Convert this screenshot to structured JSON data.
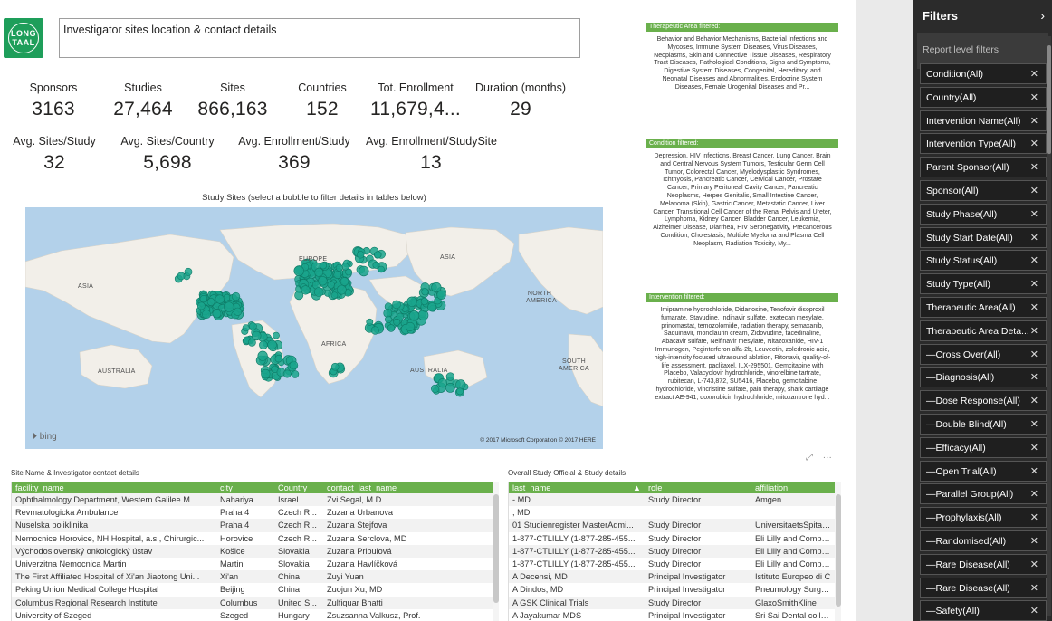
{
  "logo": {
    "line1": "LONG",
    "line2": "TAAL"
  },
  "report_title": "Investigator sites location & contact details",
  "kpis": [
    {
      "label": "Sponsors",
      "value": "3163"
    },
    {
      "label": "Studies",
      "value": "27,464"
    },
    {
      "label": "Sites",
      "value": "866,163"
    },
    {
      "label": "Countries",
      "value": "152"
    },
    {
      "label": "Tot. Enrollment",
      "value": "11,679,4..."
    },
    {
      "label": "Duration (months)",
      "value": "29"
    },
    {
      "label": "Avg. Sites/Study",
      "value": "32"
    },
    {
      "label": "Avg. Sites/Country",
      "value": "5,698"
    },
    {
      "label": "Avg. Enrollment/Study",
      "value": "369"
    },
    {
      "label": "Avg. Enrollment/StudySite",
      "value": "13"
    }
  ],
  "map": {
    "title": "Study Sites (select a bubble to filter details in tables below)",
    "labels": [
      "ASIA",
      "EUROPE",
      "NORTH AMERICA",
      "AFRICA",
      "SOUTH AMERICA",
      "AUSTRALIA",
      "AUSTRALIA",
      "ASIA"
    ],
    "bing": "bing",
    "copyright": "© 2017 Microsoft Corporation   © 2017 HERE",
    "bubble_color": "#1aa58c",
    "water_color": "#b3d1ea",
    "land_color": "#f2efe9"
  },
  "filter_cards": [
    {
      "header": "Therapeutic Area filtered:",
      "text": "Behavior and Behavior Mechanisms, Bacterial Infections and Mycoses, Immune System Diseases, Virus Diseases, Neoplasms, Skin and Connective Tissue Diseases, Respiratory Tract Diseases, Pathological Conditions, Signs and Symptoms, Digestive System Diseases, Congenital, Hereditary, and Neonatal Diseases and Abnormalities, Endocrine System Diseases, Female Urogenital Diseases and Pr..."
    },
    {
      "header": "Condition filtered:",
      "text": "Depression, HIV Infections, Breast Cancer, Lung Cancer, Brain and Central Nervous System Tumors, Testicular Germ Cell Tumor, Colorectal Cancer, Myelodysplastic Syndromes, Ichthyosis, Pancreatic Cancer, Cervical Cancer, Prostate Cancer, Primary Peritoneal Cavity Cancer, Pancreatic Neoplasms, Herpes Genitalis, Small Intestine Cancer, Melanoma (Skin), Gastric Cancer, Metastatic Cancer, Liver Cancer, Transitional Cell Cancer of the Renal Pelvis and Ureter, Lymphoma, Kidney Cancer, Bladder Cancer, Leukemia, Alzheimer Disease, Diarrhea, HIV Seronegativity, Precancerous Condition, Cholestasis, Multiple Myeloma and Plasma Cell Neoplasm, Radiation Toxicity, My..."
    },
    {
      "header": "Intervention filtered:",
      "text": "Imipramine hydrochloride, Didanosine, Tenofovir disoproxil fumarate, Stavudine, Indinavir sulfate, exatecan mesylate, prinomastat, temozolomide, radiation therapy, semaxanib, Saquinavir, monolaurin cream, Zidovudine, tacedinaline, Abacavir sulfate, Nelfinavir mesylate, Nitazoxanide, HIV-1 Immunogen, Peginterferon alfa-2b, Leuvectin, zoledronic acid, high-intensity focused ultrasound ablation, Ritonavir, quality-of-life assessment, paclitaxel, ILX-295501, Gemcitabine with Placebo, Valacyclovir hydrochloride, vinorelbine tartrate, rubitecan, L-743,872, SU5416, Placebo, gemcitabine hydrochloride, vincristine sulfate, pain therapy, shark cartilage extract AE-941, doxorubicin hydrochloride, mitoxantrone hyd..."
    }
  ],
  "sites_table": {
    "title": "Site Name & Investigator contact details",
    "columns": [
      "facility_name",
      "city",
      "Country",
      "contact_last_name"
    ],
    "rows": [
      [
        "Ophthalmology Department, Western Galilee M...",
        "Nahariya",
        "Israel",
        "Zvi Segal, M.D"
      ],
      [
        "Revmatologicka Ambulance",
        "Praha 4",
        "Czech R...",
        "Zuzana Urbanova"
      ],
      [
        "Nuselska poliklinika",
        "Praha 4",
        "Czech R...",
        "Zuzana Stejfova"
      ],
      [
        "Nemocnice Horovice, NH Hospital, a.s., Chirurgic...",
        "Horovice",
        "Czech R...",
        "Zuzana Serclova, MD"
      ],
      [
        "Východoslovenský onkologický ústav",
        "Košice",
        "Slovakia",
        "Zuzana Pribulová"
      ],
      [
        "Univerzitna Nemocnica Martin",
        "Martin",
        "Slovakia",
        "Zuzana Havlíčková"
      ],
      [
        "The First Affiliated Hospital of Xi'an Jiaotong Uni...",
        "Xi'an",
        "China",
        "Zuyi Yuan"
      ],
      [
        "Peking Union Medical College Hospital",
        "Beijing",
        "China",
        "Zuojun Xu, MD"
      ],
      [
        "Columbus Regional Research Institute",
        "Columbus",
        "United S...",
        "Zulfiquar Bhatti"
      ],
      [
        "University of Szeged",
        "Szeged",
        "Hungary",
        "Zsuzsanna Valkusz, Prof."
      ]
    ]
  },
  "officials_table": {
    "title": "Overall Study Official & Study details",
    "columns": [
      "last_name",
      "role",
      "affiliation"
    ],
    "rows": [
      [
        "- MD",
        "Study Director",
        "Amgen"
      ],
      [
        ", MD",
        "",
        ""
      ],
      [
        "01 Studienregister MasterAdmi...",
        "Study Director",
        "UniversitaetsSpital Z"
      ],
      [
        "1-877-CTLILLY (1-877-285-455...",
        "Study Director",
        "Eli Lilly and Company"
      ],
      [
        "1-877-CTLILLY (1-877-285-455...",
        "Study Director",
        "Eli Lilly and Company"
      ],
      [
        "1-877-CTLILLY (1-877-285-455...",
        "Study Director",
        "Eli Lilly and Company"
      ],
      [
        "A Decensi, MD",
        "Principal Investigator",
        "Istituto Europeo di C"
      ],
      [
        "A Dindos, MD",
        "Principal Investigator",
        "Pneumology Surgery"
      ],
      [
        "A GSK Clinical Trials",
        "Study Director",
        "GlaxoSmithKline"
      ],
      [
        "A Jayakumar MDS",
        "Principal Investigator",
        "Sri Sai Dental college"
      ]
    ]
  },
  "visual_icons": {
    "focus": "focus-mode-icon",
    "more": "more-options-icon",
    "more_glyph": "···"
  },
  "filters_pane": {
    "title": "Filters",
    "section": "Report level filters",
    "items": [
      "Condition(All)",
      "Country(All)",
      "Intervention Name(All)",
      "Intervention Type(All)",
      "Parent Sponsor(All)",
      "Sponsor(All)",
      "Study Phase(All)",
      "Study Start Date(All)",
      "Study Status(All)",
      "Study Type(All)",
      "Therapeutic Area(All)",
      "Therapeutic Area Deta...",
      "—Cross Over(All)",
      "—Diagnosis(All)",
      "—Dose Response(All)",
      "—Double Blind(All)",
      "—Efficacy(All)",
      "—Open Trial(All)",
      "—Parallel Group(All)",
      "—Prophylaxis(All)",
      "—Randomised(All)",
      "—Rare Disease(All)",
      "—Rare Disease(All)",
      "—Safety(All)"
    ]
  }
}
